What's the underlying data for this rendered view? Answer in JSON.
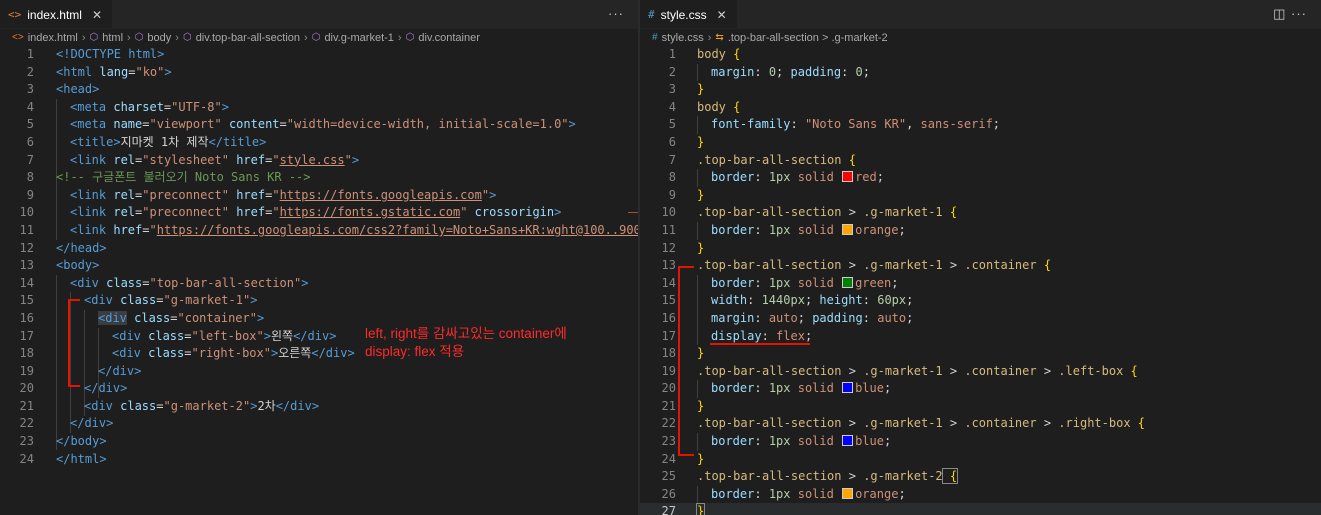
{
  "left": {
    "tab": {
      "icon": "<>",
      "label": "index.html",
      "close": "✕"
    },
    "actions": "···",
    "breadcrumb": [
      "index.html",
      "html",
      "body",
      "div.top-bar-all-section",
      "div.g-market-1",
      "div.container"
    ],
    "line_numbers": [
      "1",
      "2",
      "3",
      "4",
      "5",
      "6",
      "7",
      "8",
      "9",
      "10",
      "11",
      "12",
      "13",
      "14",
      "15",
      "16",
      "17",
      "18",
      "19",
      "20",
      "21",
      "22",
      "23",
      "24"
    ],
    "code": {
      "l1_doctype": "<!DOCTYPE html>",
      "l2_open": "<html",
      "l2_attr": " lang",
      "l2_eq": "=",
      "l2_val": "\"ko\"",
      "l2_close": ">",
      "l3": "<head>",
      "l4_open": "<meta",
      "l4_attr": " charset",
      "l4_eq": "=",
      "l4_val": "\"UTF-8\"",
      "l4_close": ">",
      "l5_open": "<meta",
      "l5_attr1": " name",
      "l5_eq1": "=",
      "l5_val1": "\"viewport\"",
      "l5_attr2": " content",
      "l5_eq2": "=",
      "l5_val2": "\"width=device-width, initial-scale=1.0\"",
      "l5_close": ">",
      "l6_open": "<title>",
      "l6_text": "지마켓 1차 제작",
      "l6_close": "</title>",
      "l7_open": "<link",
      "l7_attr1": " rel",
      "l7_eq1": "=",
      "l7_val1": "\"stylesheet\"",
      "l7_attr2": " href",
      "l7_eq2": "=",
      "l7_q1": "\"",
      "l7_url": "style.css",
      "l7_q2": "\"",
      "l7_close": ">",
      "l8_comment": "<!-- 구글폰트 불러오기 Noto Sans KR -->",
      "l9_open": "<link",
      "l9_attr1": " rel",
      "l9_eq1": "=",
      "l9_val1": "\"preconnect\"",
      "l9_attr2": " href",
      "l9_eq2": "=",
      "l9_q1": "\"",
      "l9_url": "https://fonts.googleapis.com",
      "l9_q2": "\"",
      "l9_close": ">",
      "l10_open": "<link",
      "l10_attr1": " rel",
      "l10_eq1": "=",
      "l10_val1": "\"preconnect\"",
      "l10_attr2": " href",
      "l10_eq2": "=",
      "l10_q1": "\"",
      "l10_url": "https://fonts.gstatic.com",
      "l10_q2": "\"",
      "l10_attr3": " crossorigin",
      "l10_close": ">",
      "l11_open": "<link",
      "l11_attr1": " href",
      "l11_eq1": "=",
      "l11_q1": "\"",
      "l11_url": "https://fonts.googleapis.com/css2?family=Noto+Sans+KR:wght@100..900&d",
      "l12": "</head>",
      "l13": "<body>",
      "l14_open": "<div",
      "l14_attr": " class",
      "l14_eq": "=",
      "l14_val": "\"top-bar-all-section\"",
      "l14_close": ">",
      "l15_open": "<div",
      "l15_attr": " class",
      "l15_eq": "=",
      "l15_val": "\"g-market-1\"",
      "l15_close": ">",
      "l16_open": "<div",
      "l16_attr": " class",
      "l16_eq": "=",
      "l16_val": "\"container\"",
      "l16_close": ">",
      "l17_open": "<div",
      "l17_attr": " class",
      "l17_eq": "=",
      "l17_val": "\"left-box\"",
      "l17_gt": ">",
      "l17_text": "왼쪽",
      "l17_end": "</div>",
      "l18_open": "<div",
      "l18_attr": " class",
      "l18_eq": "=",
      "l18_val": "\"right-box\"",
      "l18_gt": ">",
      "l18_text": "오른쪽",
      "l18_end": "</div>",
      "l19": "</div>",
      "l20": "</div>",
      "l21_open": "<div",
      "l21_attr": " class",
      "l21_eq": "=",
      "l21_val": "\"g-market-2\"",
      "l21_gt": ">",
      "l21_text": "2차",
      "l21_end": "</div>",
      "l22": "</div>",
      "l23": "</body>",
      "l24": "</html>"
    },
    "annotation": [
      "left, right를 감싸고있는 container에",
      "display: flex 적용"
    ]
  },
  "right": {
    "tab": {
      "icon": "#",
      "label": "style.css",
      "close": "✕"
    },
    "actions": "◫  ···",
    "breadcrumb": [
      "style.css",
      ".top-bar-all-section > .g-market-2"
    ],
    "line_numbers": [
      "1",
      "2",
      "3",
      "4",
      "5",
      "6",
      "7",
      "8",
      "9",
      "10",
      "11",
      "12",
      "13",
      "14",
      "15",
      "16",
      "17",
      "18",
      "19",
      "20",
      "21",
      "22",
      "23",
      "24",
      "25",
      "26",
      "27"
    ],
    "code": {
      "sel_body": "body",
      "ob": " {",
      "cb": "}",
      "p_margin": "margin",
      "p_padding": "padding",
      "p_font": "font-family",
      "p_border": "border",
      "p_width": "width",
      "p_height": "height",
      "p_display": "display",
      "colon": ": ",
      "semi": ";",
      "v_zero": "0",
      "v_font1": "\"Noto Sans KR\"",
      "v_comma": ", ",
      "v_font2": "sans-serif",
      "v_1px": "1px",
      "v_solid": " solid ",
      "v_1440": "1440px",
      "v_60": "60px",
      "v_auto": "auto",
      "v_flex": "flex",
      "sel_tbas": ".top-bar-all-section",
      "gt": " > ",
      "sel_gm1": ".g-market-1",
      "sel_gm2": ".g-market-2",
      "sel_cont": ".container",
      "sel_left": ".left-box",
      "sel_right": ".right-box",
      "c_red": "red",
      "c_orange": "orange",
      "c_green": "green",
      "c_blue": "blue"
    },
    "colors": {
      "red": "#ff0000",
      "orange": "#ffa500",
      "green": "#008000",
      "blue": "#0000ff"
    }
  },
  "annotation_color": "#ff2a2a"
}
